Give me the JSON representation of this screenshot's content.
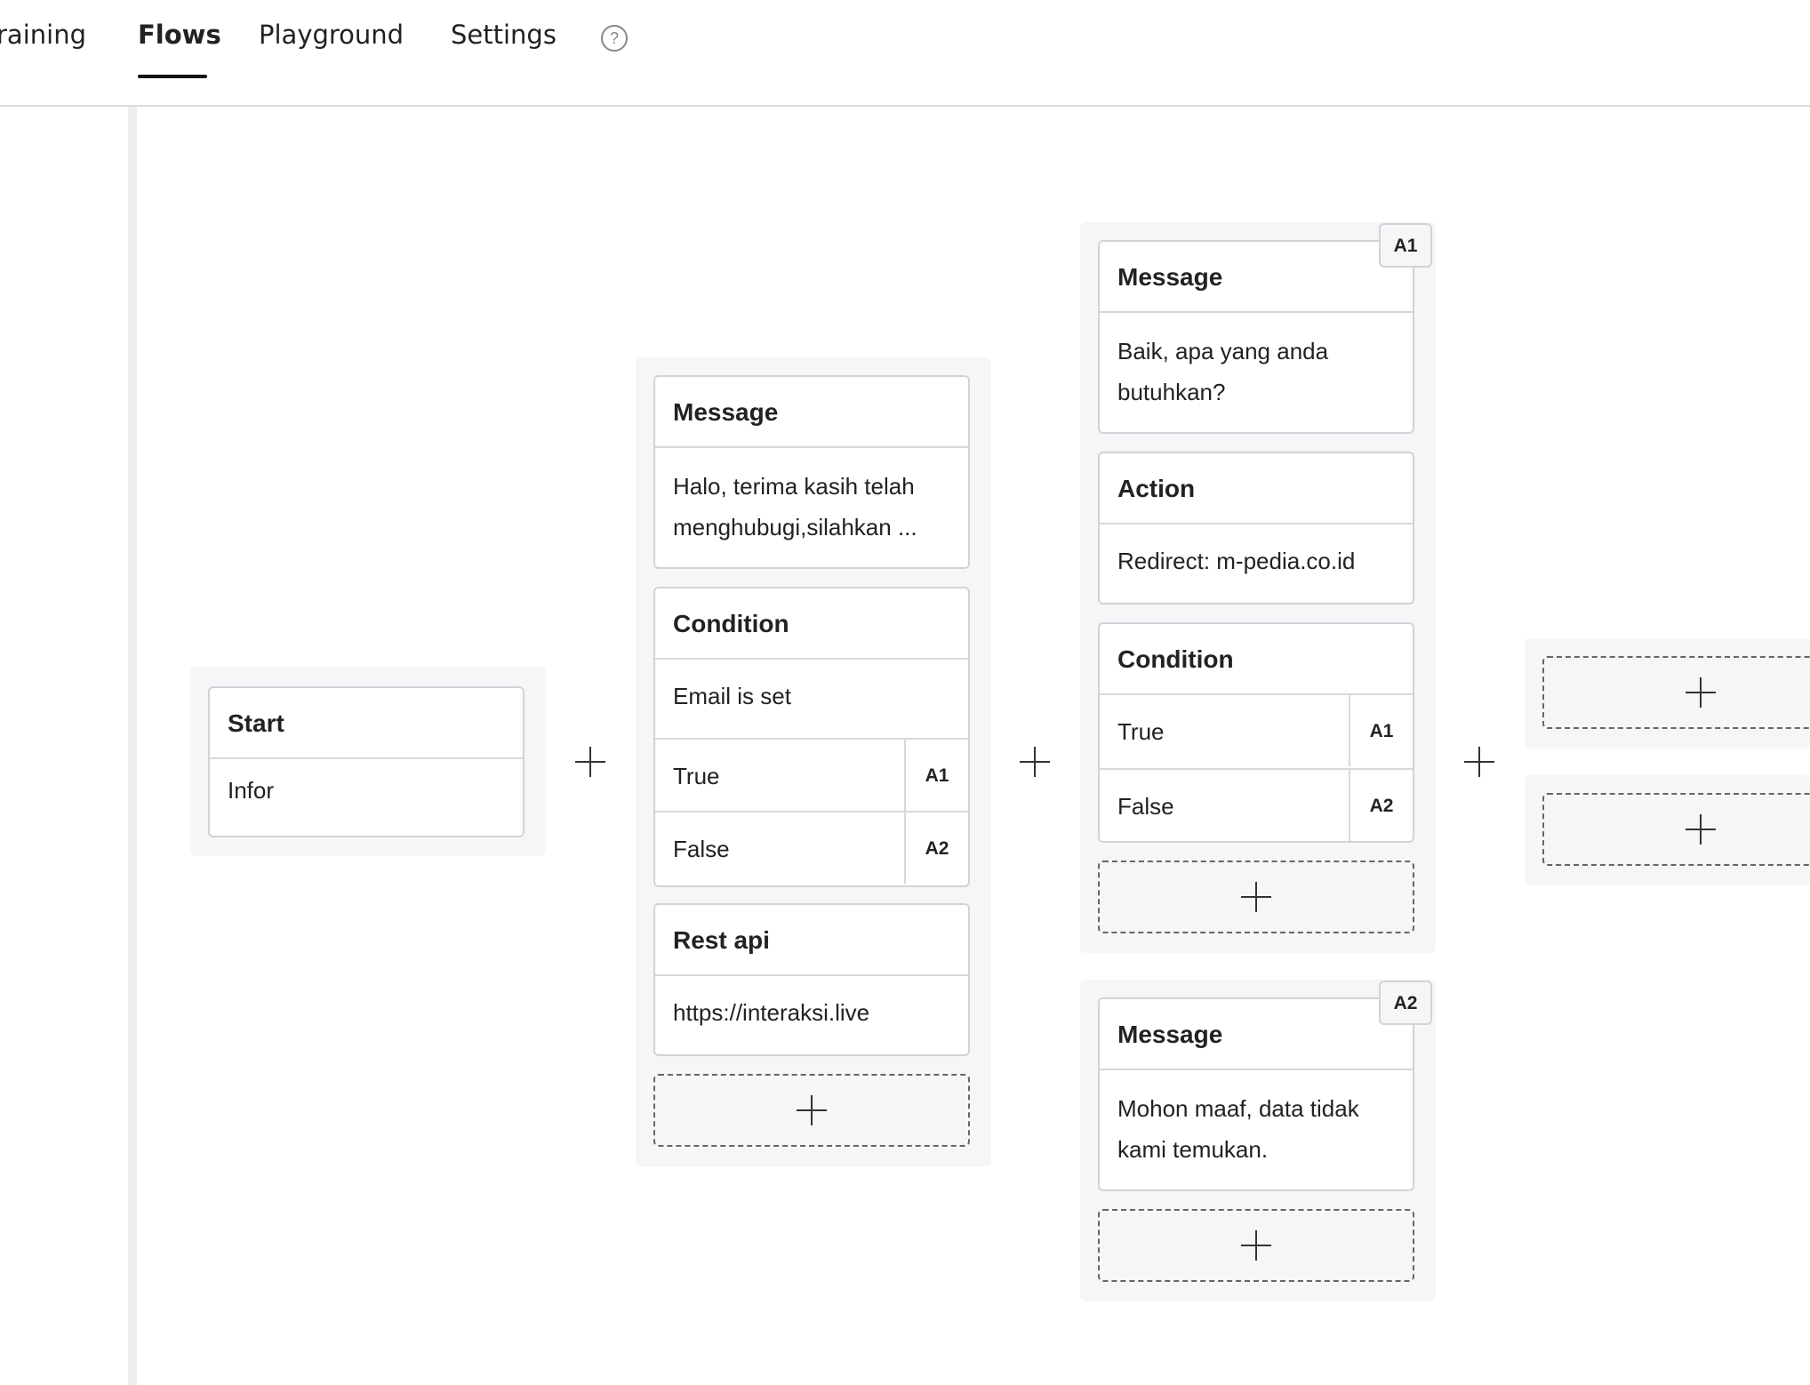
{
  "nav": {
    "tabs": [
      {
        "label": "raining"
      },
      {
        "label": "Flows"
      },
      {
        "label": "Playground"
      },
      {
        "label": "Settings"
      }
    ],
    "help_glyph": "?"
  },
  "start": {
    "title": "Start",
    "body": "Infor"
  },
  "step1": {
    "message": {
      "title": "Message",
      "body": "Halo, terima kasih telah menghubugi,silahkan ..."
    },
    "condition": {
      "title": "Condition",
      "body": "Email is set",
      "branches": [
        {
          "label": "True",
          "target": "A1"
        },
        {
          "label": "False",
          "target": "A2"
        }
      ]
    },
    "rest": {
      "title": "Rest api",
      "body": "https://interaksi.live"
    }
  },
  "groupA1": {
    "tag": "A1",
    "message": {
      "title": "Message",
      "body": "Baik, apa yang anda butuhkan?"
    },
    "action": {
      "title": "Action",
      "body": "Redirect: m-pedia.co.id"
    },
    "condition": {
      "title": "Condition",
      "branches": [
        {
          "label": "True",
          "target": "A1"
        },
        {
          "label": "False",
          "target": "A2"
        }
      ]
    }
  },
  "groupA2": {
    "tag": "A2",
    "message": {
      "title": "Message",
      "body": "Mohon maaf, data tidak kami temukan."
    }
  }
}
